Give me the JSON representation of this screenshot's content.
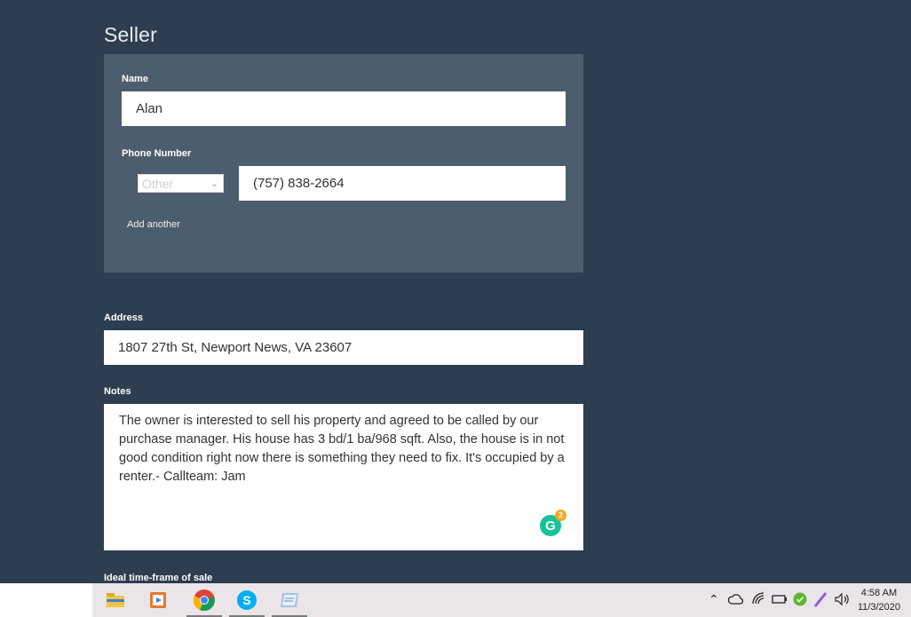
{
  "seller": {
    "title": "Seller",
    "name_label": "Name",
    "name_value": "Alan",
    "phone_label": "Phone Number",
    "phone_type": "Other",
    "phone_value": "(757) 838-2664",
    "add_another": "Add another"
  },
  "address": {
    "label": "Address",
    "value": "1807 27th St, Newport News, VA 23607"
  },
  "notes": {
    "label": "Notes",
    "value": "The owner is interested to sell his property and agreed to be called by our purchase manager. His house has 3 bd/1 ba/968 sqft. Also, the house is in not good condition right now there is something they need to fix. It's occupied by a renter.- Callteam: Jam",
    "grammarly_letter": "G",
    "grammarly_count": "2"
  },
  "timeframe": {
    "label": "Ideal time-frame of sale"
  },
  "taskbar": {
    "apps": [
      {
        "name": "file-explorer-icon"
      },
      {
        "name": "media-player-icon"
      },
      {
        "name": "chrome-icon"
      },
      {
        "name": "skype-icon",
        "letter": "S"
      },
      {
        "name": "notepad-icon"
      }
    ],
    "time": "4:58 AM",
    "date": "11/3/2020"
  },
  "colors": {
    "background": "#2c3e50",
    "panel": "#4c5d6d",
    "grammarly": "#15c39a"
  }
}
